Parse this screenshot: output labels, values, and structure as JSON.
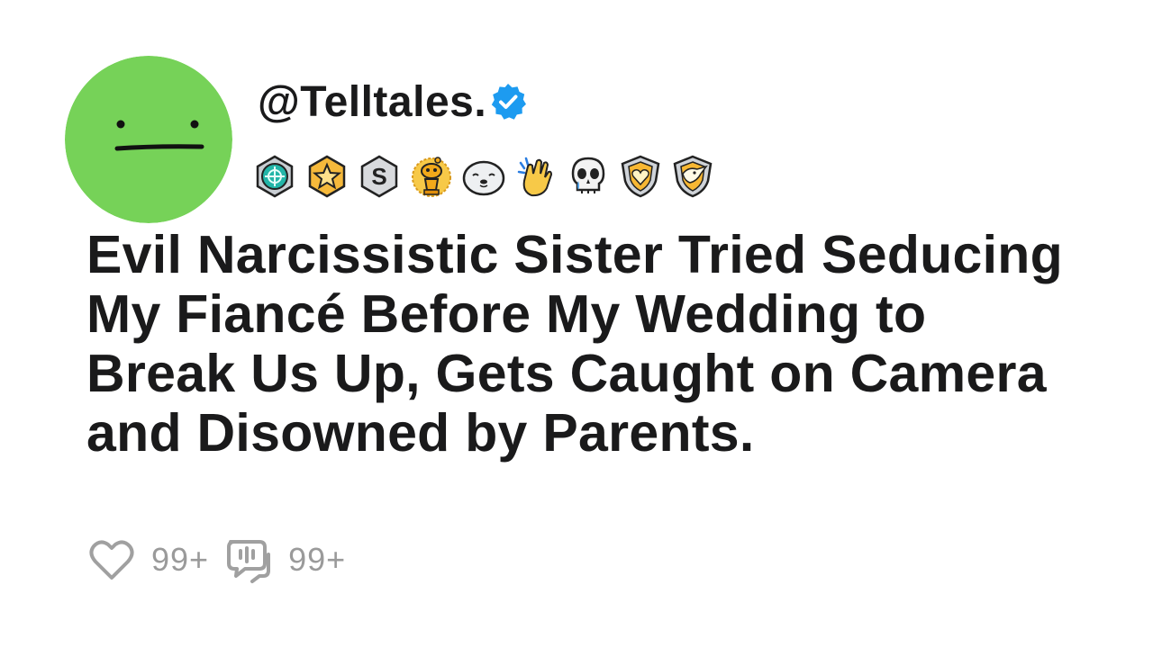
{
  "post": {
    "username": "@Telltales.",
    "verified": true,
    "avatar": {
      "icon": "neutral-face-icon",
      "color": "#76d258"
    },
    "awards": [
      {
        "icon": "helpful-award-icon"
      },
      {
        "icon": "star-award-icon"
      },
      {
        "icon": "silver-s-award-icon"
      },
      {
        "icon": "gold-snoo-award-icon"
      },
      {
        "icon": "seal-award-icon"
      },
      {
        "icon": "clapping-hands-award-icon"
      },
      {
        "icon": "crying-skull-award-icon"
      },
      {
        "icon": "gold-heart-shield-award-icon"
      },
      {
        "icon": "gold-bird-shield-award-icon"
      }
    ],
    "title": "Evil Narcissistic Sister Tried Seducing My Fiancé Before My Wedding to Break Us Up, Gets Caught on Camera and Disowned by Parents.",
    "likes_count": "99+",
    "comments_count": "99+"
  },
  "colors": {
    "text": "#1a1a1b",
    "verified_badge": "#1d9bf0",
    "muted": "#9a9a9a",
    "avatar_bg": "#76d258"
  }
}
